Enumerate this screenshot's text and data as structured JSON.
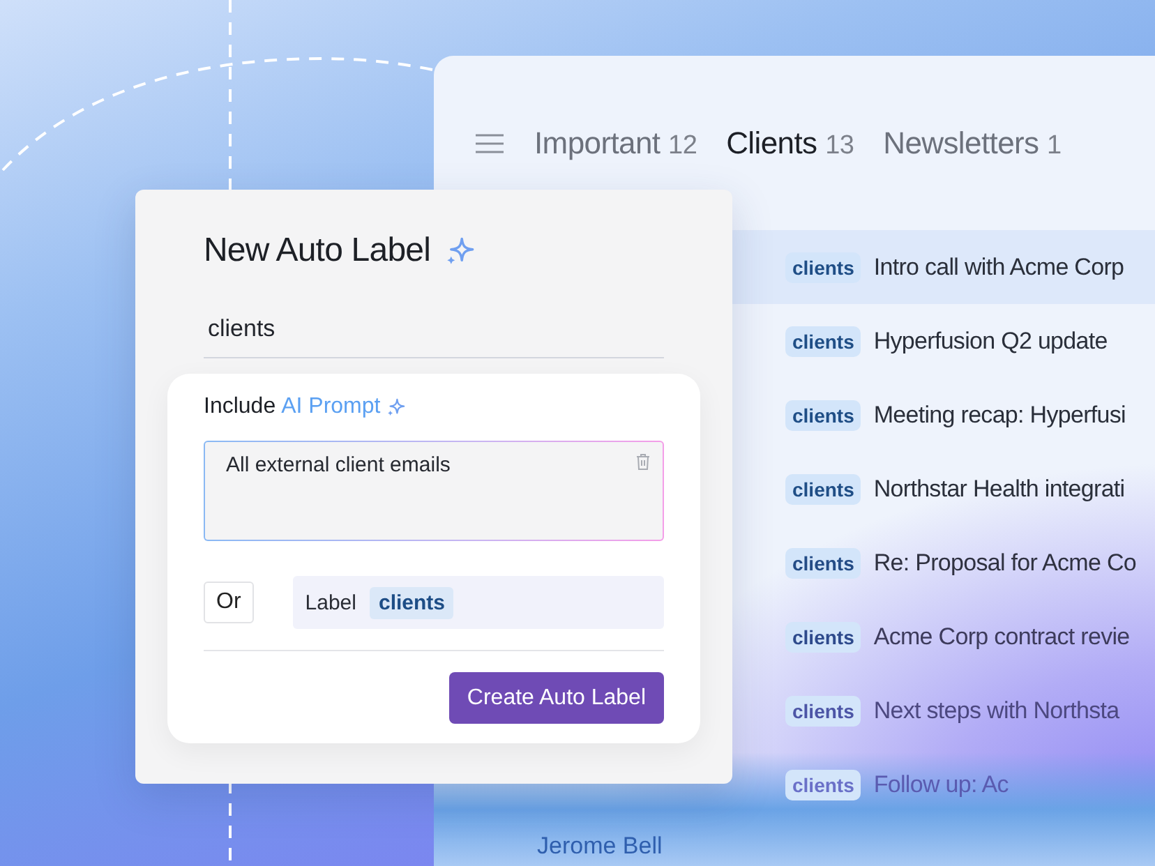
{
  "mail": {
    "tabs": [
      {
        "label": "Important",
        "count": "12",
        "selected": false
      },
      {
        "label": "Clients",
        "count": "13",
        "selected": true
      },
      {
        "label": "Newsletters",
        "count": "1",
        "selected": false
      }
    ],
    "messages": [
      {
        "tag": "clients",
        "subject": "Intro call with Acme Corp",
        "selected": true
      },
      {
        "tag": "clients",
        "subject": "Hyperfusion Q2 update",
        "selected": false
      },
      {
        "tag": "clients",
        "subject": "Meeting recap: Hyperfusi",
        "selected": false
      },
      {
        "tag": "clients",
        "subject": "Northstar Health integrati",
        "selected": false
      },
      {
        "tag": "clients",
        "subject": "Re: Proposal for Acme Co",
        "selected": false
      },
      {
        "tag": "clients",
        "subject": "Acme Corp contract revie",
        "selected": false
      },
      {
        "tag": "clients",
        "subject": "Next steps with Northsta",
        "selected": false
      },
      {
        "tag": "clients",
        "subject": "Follow up: Ac",
        "selected": false
      }
    ],
    "sender": "Jerome Bell"
  },
  "dialog": {
    "title": "New Auto Label",
    "name_value": "clients",
    "include_label": "Include",
    "ai_prompt_label": "AI Prompt",
    "prompt_value": "All external client emails",
    "or_label": "Or",
    "label_prefix": "Label",
    "label_chip": "clients",
    "create_button": "Create Auto Label"
  }
}
